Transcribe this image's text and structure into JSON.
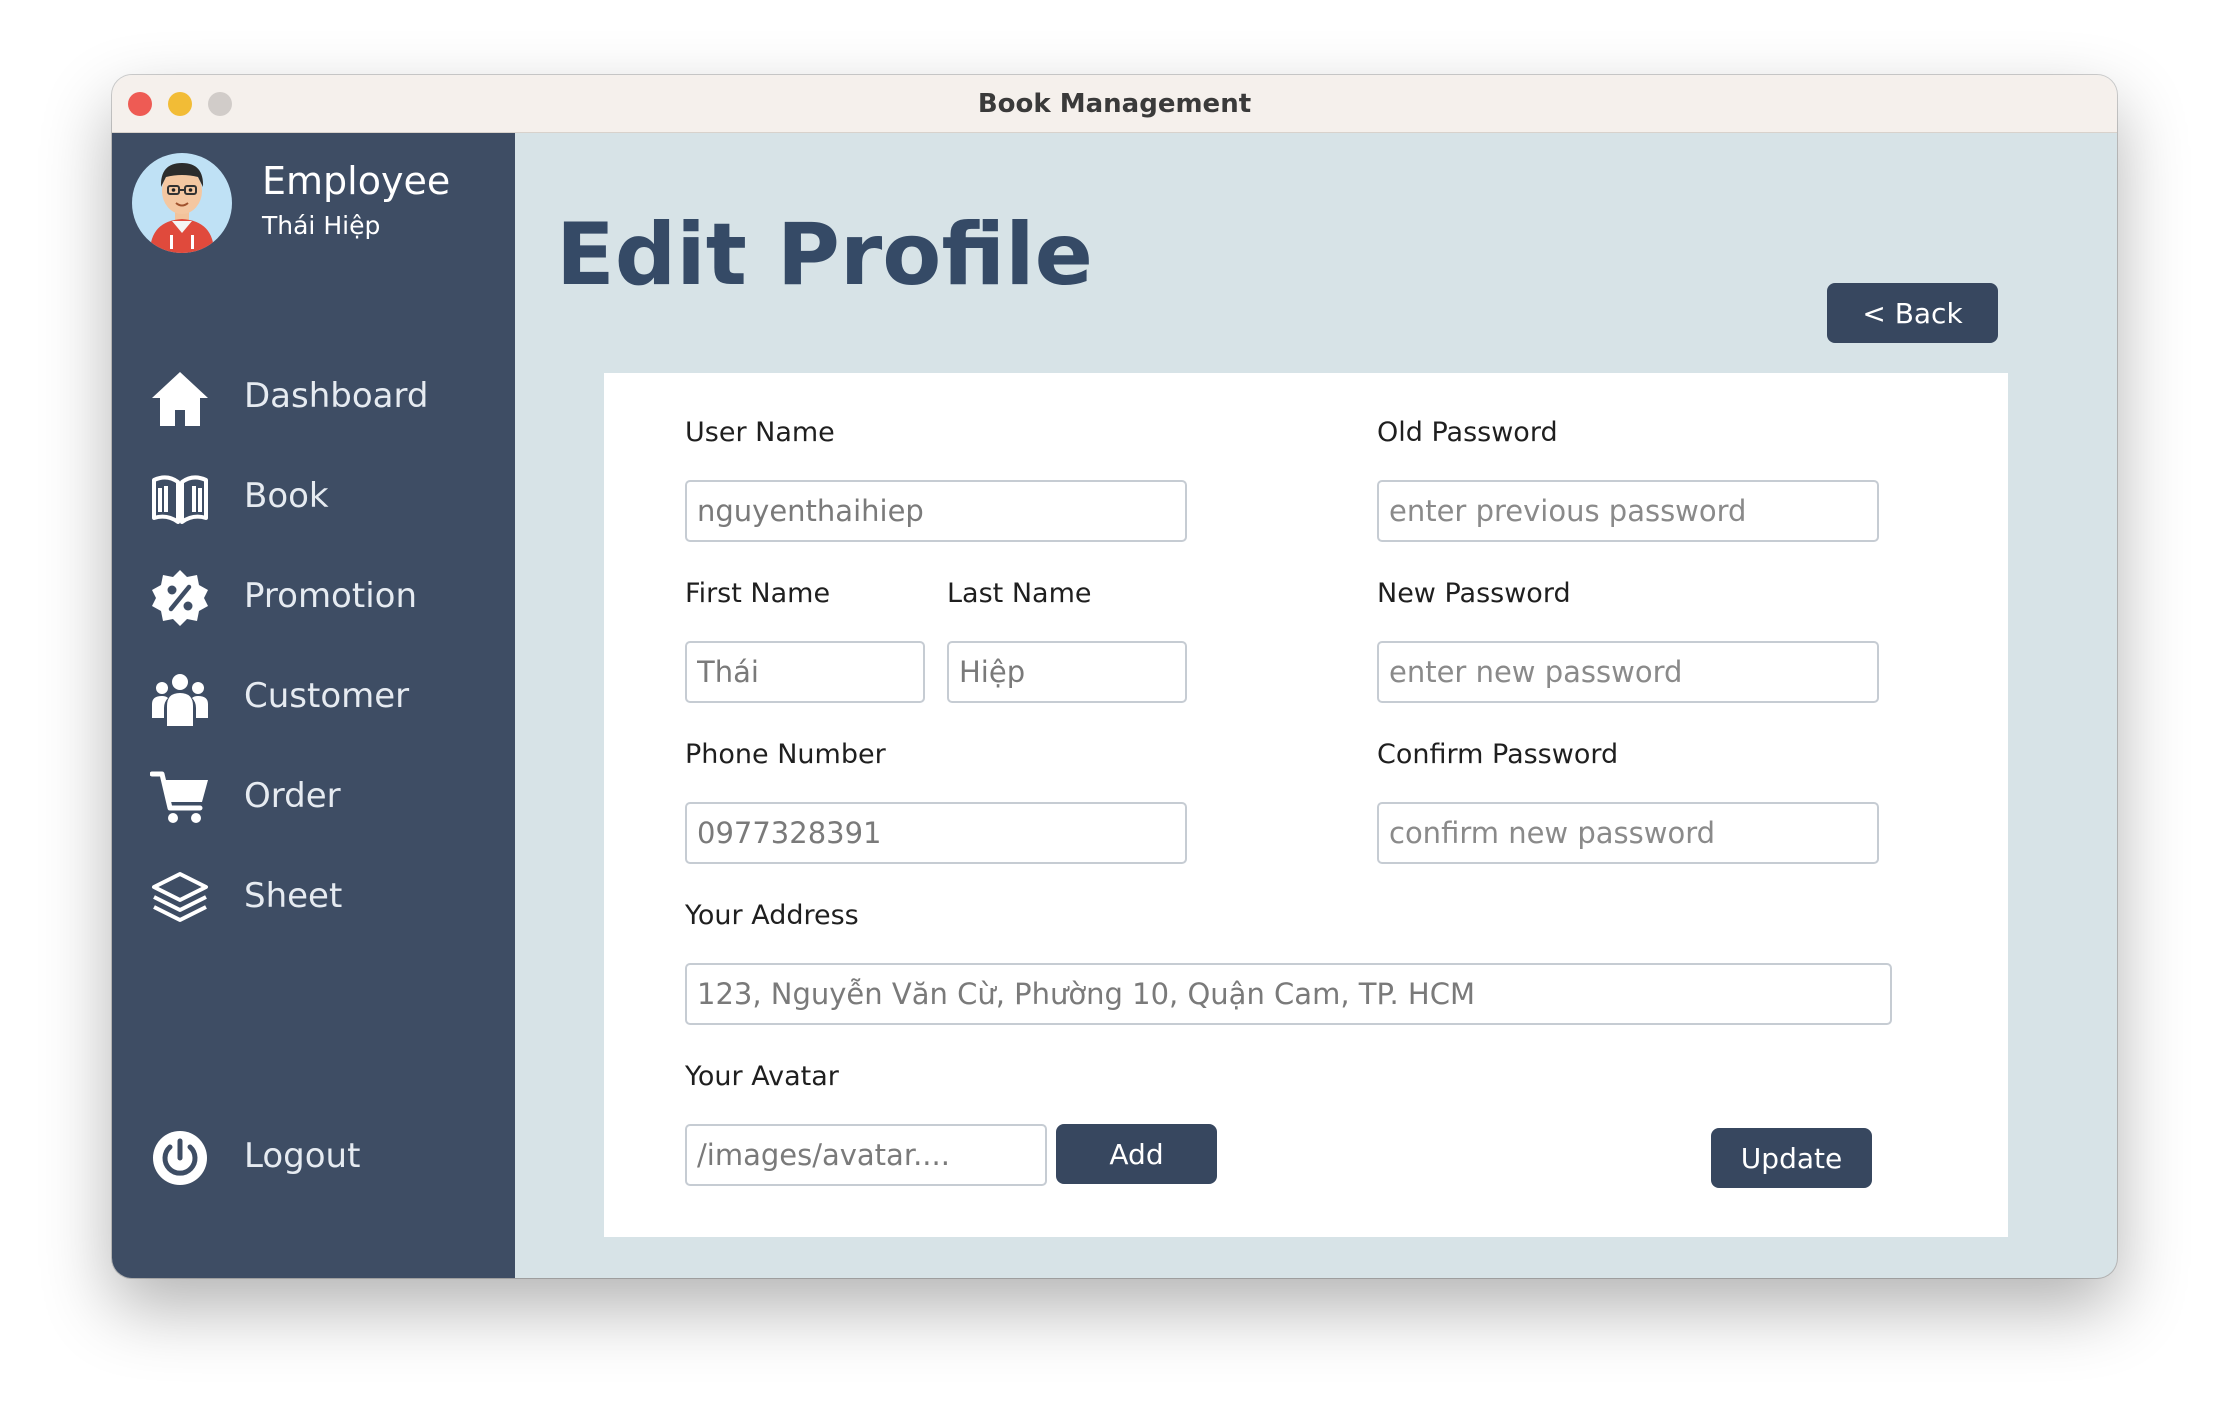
{
  "window": {
    "title": "Book Management"
  },
  "sidebar": {
    "role": "Employee",
    "name": "Thái Hiệp",
    "items": [
      {
        "label": "Dashboard",
        "icon": "home-icon"
      },
      {
        "label": "Book",
        "icon": "book-icon"
      },
      {
        "label": "Promotion",
        "icon": "discount-badge-icon"
      },
      {
        "label": "Customer",
        "icon": "people-icon"
      },
      {
        "label": "Order",
        "icon": "cart-icon"
      },
      {
        "label": "Sheet",
        "icon": "layers-icon"
      }
    ],
    "logout": {
      "label": "Logout",
      "icon": "power-icon"
    }
  },
  "main": {
    "title": "Edit Profile",
    "back_label": "<  Back",
    "form": {
      "username": {
        "label": "User Name",
        "value": "nguyenthaihiep"
      },
      "first_name": {
        "label": "First Name",
        "value": "Thái"
      },
      "last_name": {
        "label": "Last Name",
        "value": "Hiệp"
      },
      "phone": {
        "label": "Phone Number",
        "value": "0977328391"
      },
      "old_password": {
        "label": "Old Password",
        "placeholder": "enter previous password"
      },
      "new_password": {
        "label": "New Password",
        "placeholder": "enter new password"
      },
      "confirm_password": {
        "label": "Confirm Password",
        "placeholder": "confirm new password"
      },
      "address": {
        "label": "Your Address",
        "value": "123, Nguyễn Văn Cừ, Phường 10, Quận Cam, TP. HCM"
      },
      "avatar": {
        "label": "Your Avatar",
        "value": "/images/avatar...."
      },
      "add_label": "Add",
      "update_label": "Update"
    }
  },
  "colors": {
    "sidebar_bg": "#3e4d64",
    "main_bg": "#d7e3e7",
    "title_color": "#354a66",
    "button_bg": "#37475f"
  }
}
